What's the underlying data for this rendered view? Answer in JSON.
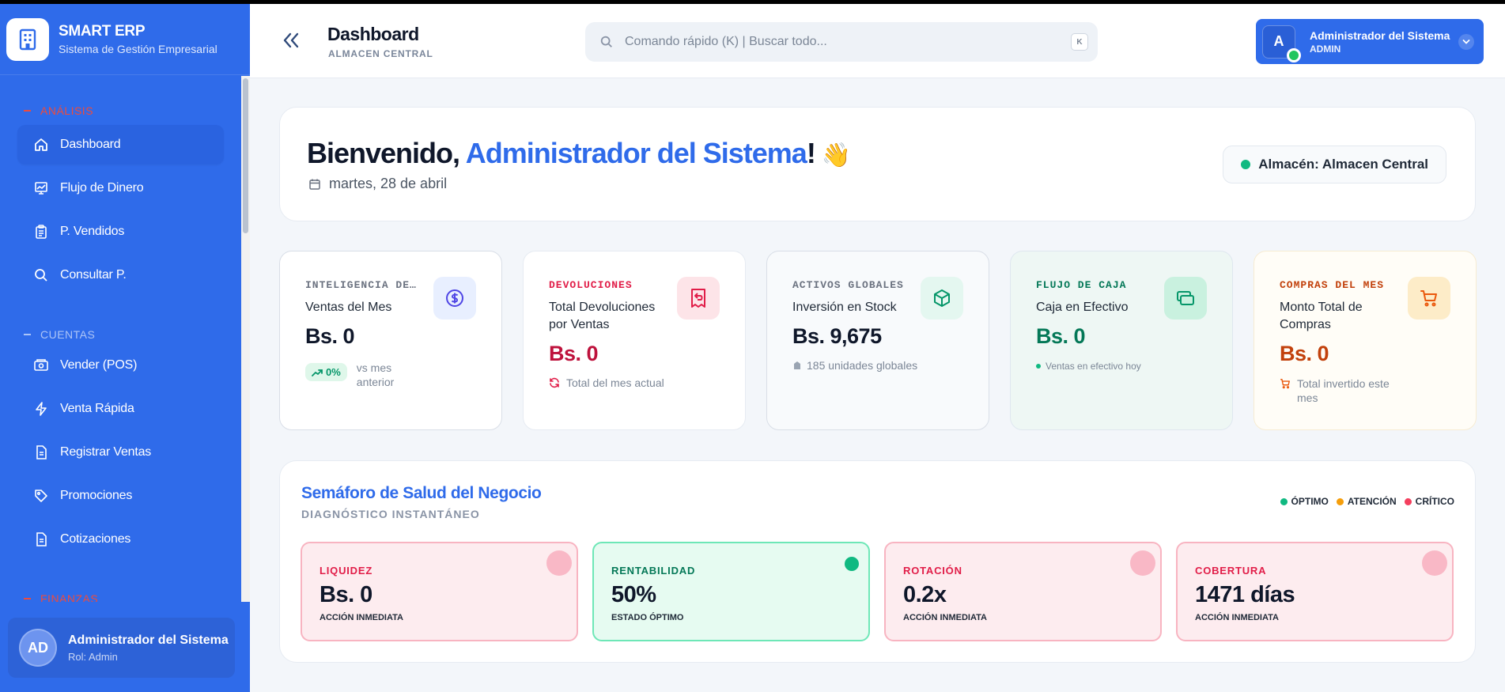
{
  "brand": {
    "title": "SMART ERP",
    "subtitle": "Sistema de Gestión Empresarial"
  },
  "sidebar": {
    "sections": [
      {
        "label": "ANÁLISIS",
        "items": [
          {
            "label": "Dashboard",
            "icon": "home-icon",
            "active": true
          },
          {
            "label": "Flujo de Dinero",
            "icon": "chart-icon"
          },
          {
            "label": "P. Vendidos",
            "icon": "clipboard-icon"
          },
          {
            "label": "Consultar P.",
            "icon": "search-icon"
          }
        ]
      },
      {
        "label": "CUENTAS",
        "items": [
          {
            "label": "Vender (POS)",
            "icon": "cash-register-icon"
          },
          {
            "label": "Venta Rápida",
            "icon": "lightning-icon"
          },
          {
            "label": "Registrar Ventas",
            "icon": "document-icon"
          },
          {
            "label": "Promociones",
            "icon": "tag-icon"
          },
          {
            "label": "Cotizaciones",
            "icon": "document-icon"
          }
        ]
      },
      {
        "label": "FINANZAS",
        "items": []
      }
    ],
    "user": {
      "initials": "AD",
      "name": "Administrador del Sistema",
      "role": "Rol: Admin"
    }
  },
  "header": {
    "title": "Dashboard",
    "subtitle": "ALMACEN CENTRAL",
    "search_placeholder": "Comando rápido (K) | Buscar todo...",
    "search_key": "K",
    "profile": {
      "initial": "A",
      "name": "Administrador del Sistema",
      "role": "ADMIN"
    }
  },
  "welcome": {
    "greeting": "Bienvenido, ",
    "name": "Administrador del Sistema",
    "exclaim": "!",
    "wave": "👋",
    "date": "martes, 28 de abril",
    "almacen": "Almacén: Almacen Central"
  },
  "kpis": [
    {
      "label": "INTELIGENCIA DE…",
      "title": "Ventas del Mes",
      "value": "Bs. 0",
      "badge": "0%",
      "foot": "vs mes anterior",
      "color": "#6b7280",
      "value_color": "#0f172a",
      "icon": "dollar-icon"
    },
    {
      "label": "DEVOLUCIONES",
      "title": "Total Devoluciones por Ventas",
      "value": "Bs. 0",
      "foot": "Total del mes actual",
      "color": "#e11d48",
      "value_color": "#be123c",
      "icon": "receipt-return-icon"
    },
    {
      "label": "ACTIVOS GLOBALES",
      "title": "Inversión en Stock",
      "value": "Bs. 9,675",
      "foot": "185 unidades globales",
      "color": "#6b7280",
      "value_color": "#0f172a",
      "icon": "box-icon"
    },
    {
      "label": "FLUJO DE CAJA",
      "title": "Caja en Efectivo",
      "value": "Bs. 0",
      "foot": "Ventas en efectivo hoy",
      "color": "#047857",
      "value_color": "#047857",
      "icon": "cash-icon"
    },
    {
      "label": "COMPRAS DEL MES",
      "title": "Monto Total de Compras",
      "value": "Bs. 0",
      "foot": "Total invertido este mes",
      "color": "#c2410c",
      "value_color": "#c2410c",
      "icon": "cart-icon"
    }
  ],
  "health": {
    "title": "Semáforo de Salud del Negocio",
    "subtitle": "DIAGNÓSTICO INSTANTÁNEO",
    "legend": [
      {
        "label": "ÓPTIMO",
        "color": "#10b981"
      },
      {
        "label": "ATENCIÓN",
        "color": "#f59e0b"
      },
      {
        "label": "CRÍTICO",
        "color": "#f43f5e"
      }
    ],
    "cards": [
      {
        "label": "LIQUIDEZ",
        "value": "Bs. 0",
        "status": "ACCIÓN INMEDIATA",
        "state": "red"
      },
      {
        "label": "RENTABILIDAD",
        "value": "50%",
        "status": "ESTADO ÓPTIMO",
        "state": "green"
      },
      {
        "label": "ROTACIÓN",
        "value": "0.2x",
        "status": "ACCIÓN INMEDIATA",
        "state": "red"
      },
      {
        "label": "COBERTURA",
        "value": "1471 días",
        "status": "ACCIÓN INMEDIATA",
        "state": "red"
      }
    ]
  }
}
